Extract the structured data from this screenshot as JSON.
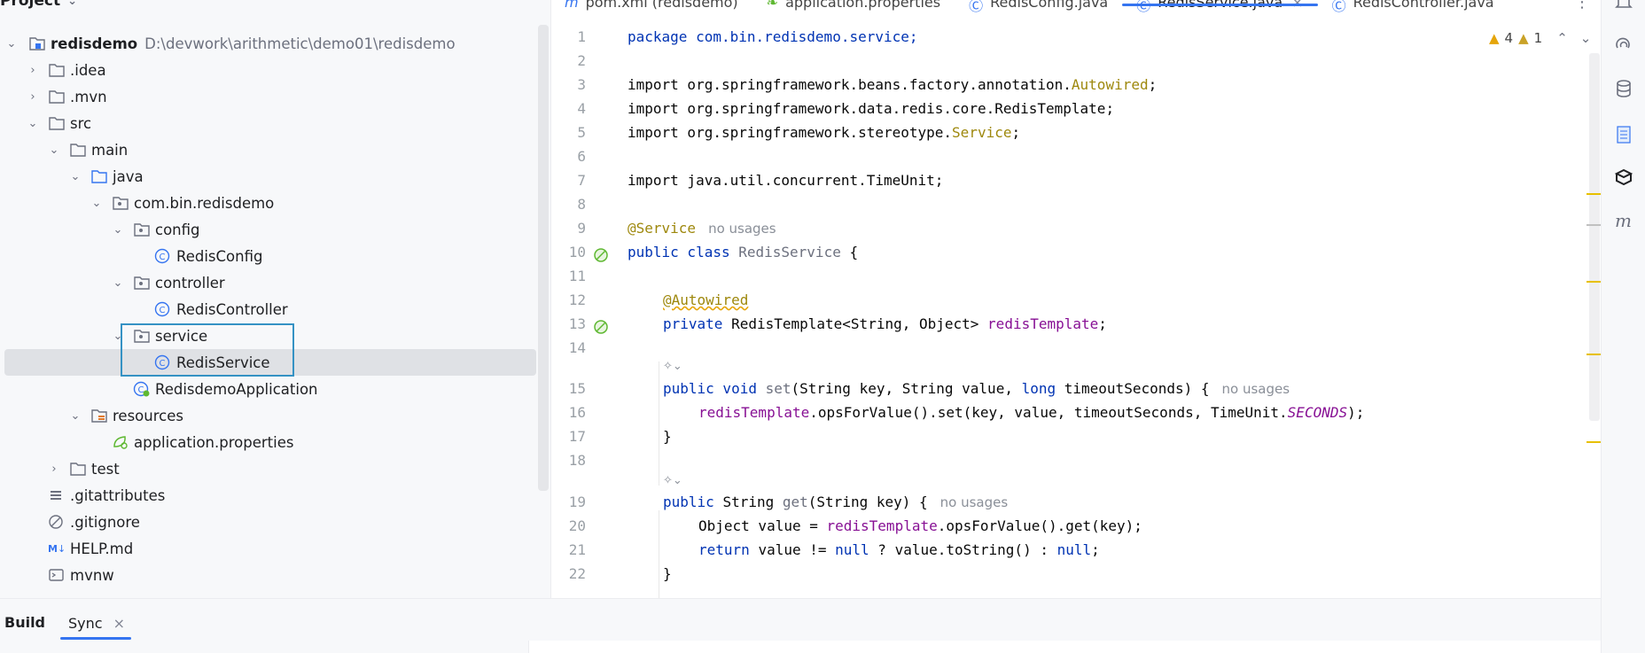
{
  "project": {
    "title": "Project",
    "tree": [
      {
        "label": "redisdemo",
        "path": "D:\\devwork\\arithmetic\\demo01\\redisdemo",
        "bold": true
      },
      {
        "label": ".idea"
      },
      {
        "label": ".mvn"
      },
      {
        "label": "src"
      },
      {
        "label": "main"
      },
      {
        "label": "java"
      },
      {
        "label": "com.bin.redisdemo"
      },
      {
        "label": "config"
      },
      {
        "label": "RedisConfig"
      },
      {
        "label": "controller"
      },
      {
        "label": "RedisController"
      },
      {
        "label": "service"
      },
      {
        "label": "RedisService"
      },
      {
        "label": "RedisdemoApplication"
      },
      {
        "label": "resources"
      },
      {
        "label": "application.properties"
      },
      {
        "label": "test"
      },
      {
        "label": ".gitattributes"
      },
      {
        "label": ".gitignore"
      },
      {
        "label": "HELP.md"
      },
      {
        "label": "mvnw"
      }
    ]
  },
  "tabs": [
    {
      "label": "pom.xml (redisdemo)"
    },
    {
      "label": "application.properties"
    },
    {
      "label": "RedisConfig.java"
    },
    {
      "label": "RedisService.java",
      "active": true
    },
    {
      "label": "RedisController.java"
    }
  ],
  "inspections": {
    "warnings": "4",
    "weak_warnings": "1"
  },
  "code": {
    "line_numbers": [
      "1",
      "2",
      "3",
      "4",
      "5",
      "6",
      "7",
      "8",
      "9",
      "10",
      "11",
      "12",
      "13",
      "14",
      "15",
      "16",
      "17",
      "18",
      "19",
      "20",
      "21",
      "22"
    ],
    "hint_no_usages": "no usages",
    "l1": "package com.bin.redisdemo.service;",
    "l3a": "import org.springframework.beans.factory.annotation.",
    "l3b": "Autowired",
    "l4": "import org.springframework.data.redis.core.RedisTemplate;",
    "l5a": "import org.springframework.stereotype.",
    "l5b": "Service",
    "l7": "import java.util.concurrent.TimeUnit;",
    "l9": "@Service",
    "l10a": "public class ",
    "l10b": "RedisService",
    "l10c": " {",
    "l12": "@Autowired",
    "l13a": "private ",
    "l13b": "RedisTemplate<String, Object> ",
    "l13c": "redisTemplate",
    "l13d": ";",
    "l15a": "public void ",
    "l15b": "set",
    "l15c": "(String key, String value, ",
    "l15d": "long",
    "l15e": " timeoutSeconds) {",
    "l16a": "redisTemplate",
    "l16b": ".opsForValue().set(key, value, timeoutSeconds, TimeUnit.",
    "l16c": "SECONDS",
    "l16d": ");",
    "l17": "}",
    "l19a": "public ",
    "l19b": "String ",
    "l19c": "get",
    "l19d": "(String key) {",
    "l20a": "Object value = ",
    "l20b": "redisTemplate",
    "l20c": ".opsForValue().get(key);",
    "l21a": "return ",
    "l21b": "value != ",
    "l21c": "null",
    "l21d": " ? value.toString() : ",
    "l21e": "null",
    "l21f": ";",
    "l22": "}"
  },
  "bottom": {
    "build_label": "Build",
    "sync_label": "Sync"
  },
  "colors": {
    "accent": "#3574f0",
    "keyword": "#0033b3",
    "annotation": "#9e880d",
    "field": "#871094",
    "selection": "#dfe1e5",
    "highlight_box": "#3592c4"
  }
}
